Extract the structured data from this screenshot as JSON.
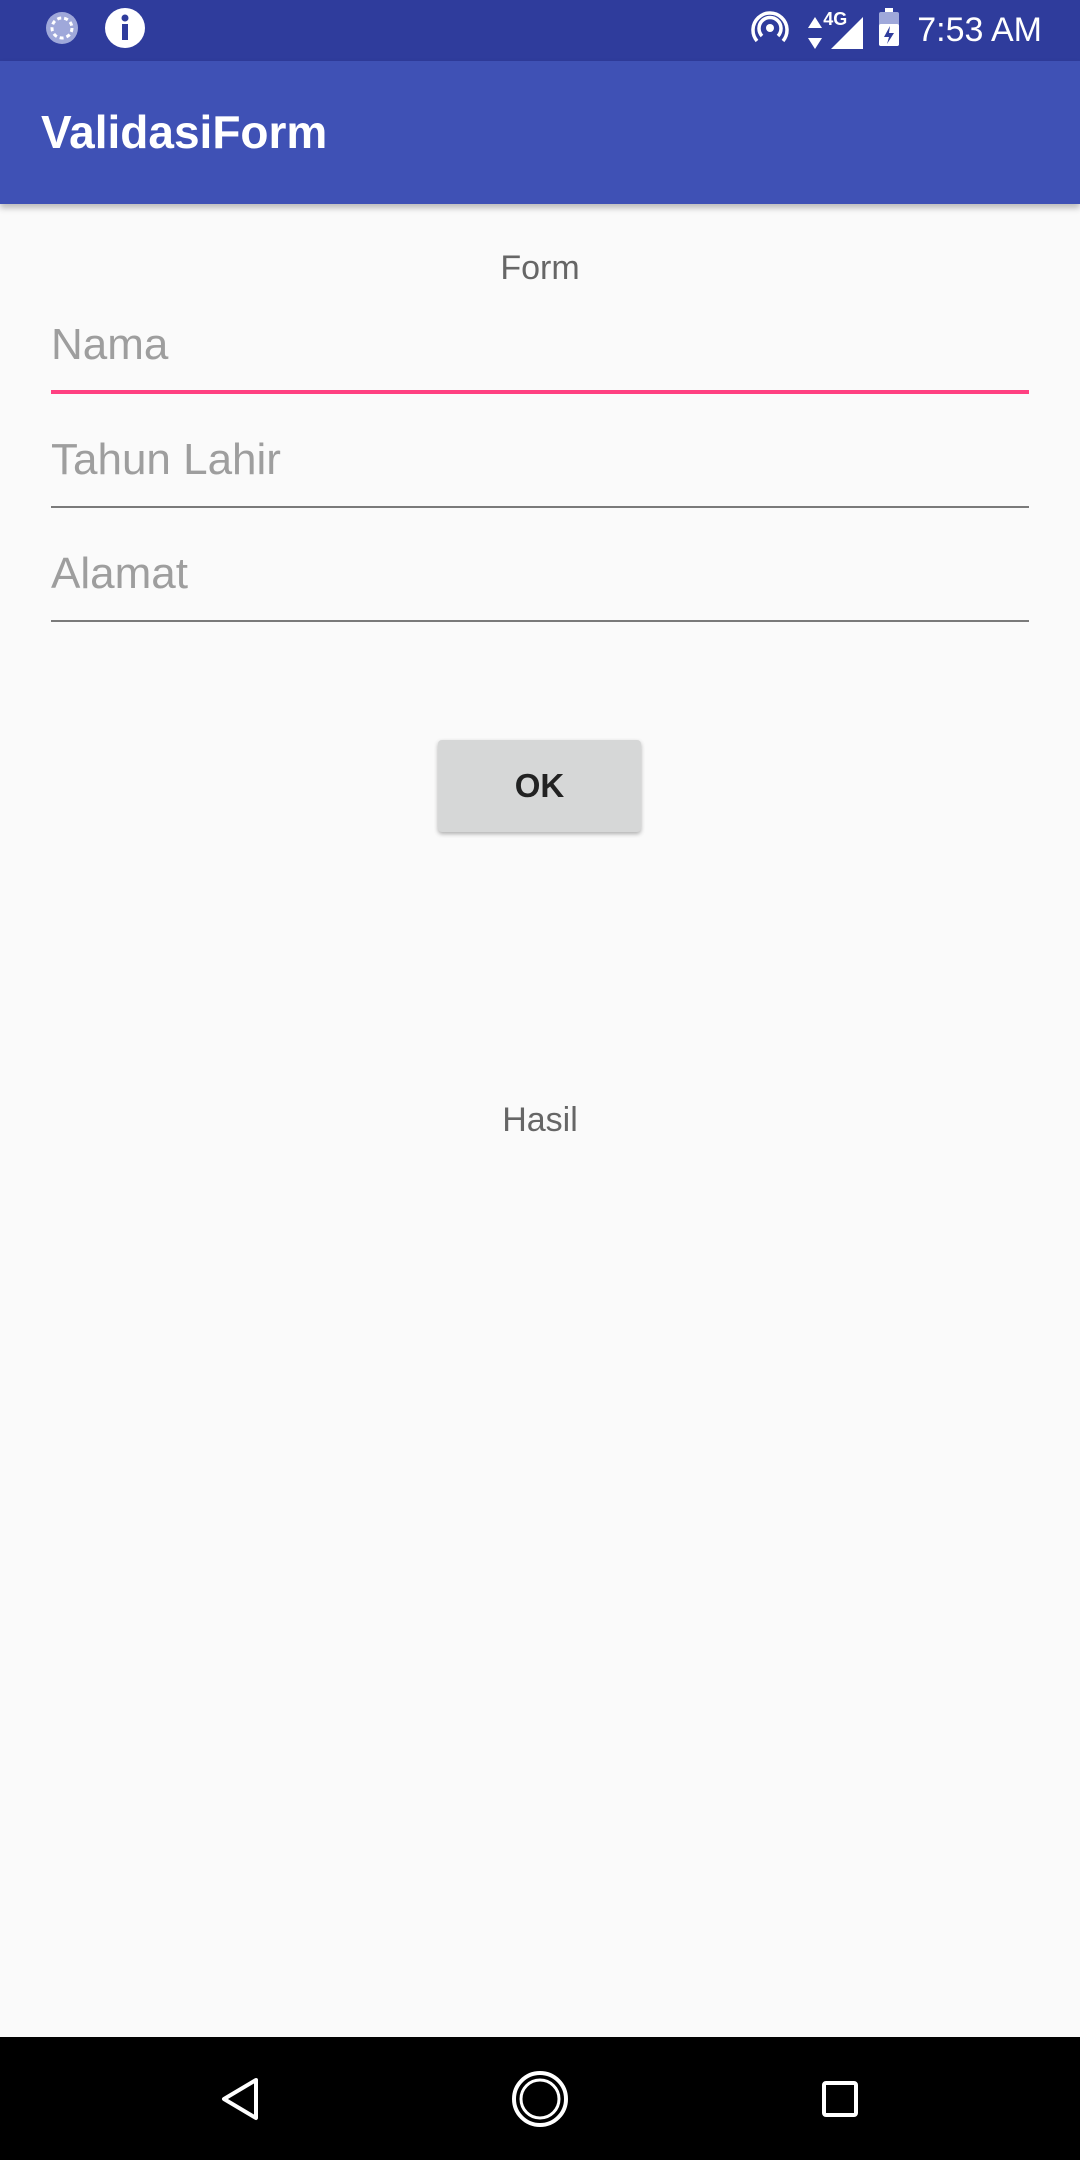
{
  "status_bar": {
    "time": "7:53 AM",
    "icons": [
      "sync-icon",
      "info-icon",
      "hotspot-icon",
      "data-arrows-icon",
      "signal-icon",
      "battery-icon"
    ],
    "network": "4G"
  },
  "app_bar": {
    "title": "ValidasiForm",
    "color": "#3f51b5"
  },
  "form": {
    "heading": "Form",
    "fields": {
      "nama": {
        "placeholder": "Nama",
        "value": ""
      },
      "tahun_lahir": {
        "placeholder": "Tahun Lahir",
        "value": ""
      },
      "alamat": {
        "placeholder": "Alamat",
        "value": ""
      }
    },
    "ok_label": "OK",
    "accent_color": "#ff4081"
  },
  "result": {
    "label": "Hasil"
  },
  "nav_bar": {
    "icons": [
      "back-icon",
      "home-icon",
      "recents-icon"
    ]
  }
}
